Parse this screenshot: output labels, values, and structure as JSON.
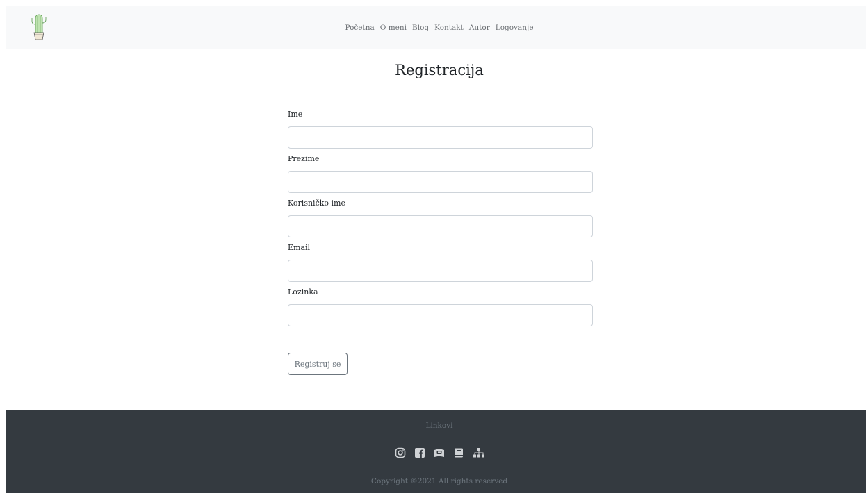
{
  "nav": {
    "items": [
      {
        "label": "Početna"
      },
      {
        "label": "O meni"
      },
      {
        "label": "Blog"
      },
      {
        "label": "Kontakt"
      },
      {
        "label": "Autor"
      },
      {
        "label": "Logovanje"
      }
    ]
  },
  "page": {
    "title": "Registracija"
  },
  "form": {
    "fields": [
      {
        "label": "Ime",
        "value": "",
        "placeholder": ""
      },
      {
        "label": "Prezime",
        "value": "",
        "placeholder": ""
      },
      {
        "label": "Korisničko ime",
        "value": "",
        "placeholder": ""
      },
      {
        "label": "Email",
        "value": "",
        "placeholder": ""
      },
      {
        "label": "Lozinka",
        "value": "",
        "placeholder": ""
      }
    ],
    "submit_label": "Registruj se"
  },
  "footer": {
    "heading": "Linkovi",
    "icons": [
      "instagram-icon",
      "facebook-icon",
      "book-icon",
      "notebook-icon",
      "sitemap-icon"
    ],
    "copyright": "Copyright ©2021 All rights reserved"
  },
  "colors": {
    "navbar_bg": "#f8f9fa",
    "footer_bg": "#343a40",
    "muted": "#6c757d",
    "logo_green": "#7cc46e"
  }
}
